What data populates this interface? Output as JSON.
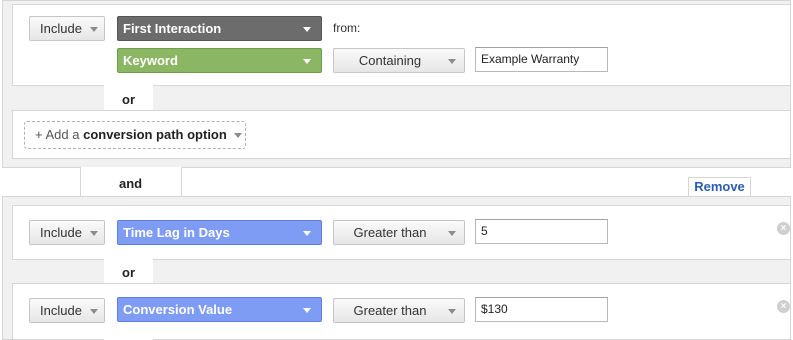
{
  "group1": {
    "row1": {
      "include_label": "Include",
      "dimension_label": "First Interaction",
      "from_label": "from:"
    },
    "row2": {
      "dimension_label": "Keyword",
      "operator_label": "Containing",
      "value": "Example Warranty"
    },
    "or_label": "or",
    "add_option": {
      "prefix": "+ Add a",
      "strong": "conversion path option"
    }
  },
  "and_label": "and",
  "remove_label": "Remove",
  "group2": {
    "row1": {
      "include_label": "Include",
      "dimension_label": "Time Lag in Days",
      "operator_label": "Greater than",
      "value": "5"
    },
    "or_label": "or",
    "row2": {
      "include_label": "Include",
      "dimension_label": "Conversion Value",
      "operator_label": "Greater than",
      "value": "$130"
    }
  },
  "colors": {
    "dimension_dark": "#6c6c6c",
    "dimension_green": "#8bb765",
    "dimension_blue": "#7f9cf5",
    "link_blue": "#2a5db0"
  },
  "icons": {
    "dropdown": "caret-down",
    "remove_row": "close-circle"
  }
}
